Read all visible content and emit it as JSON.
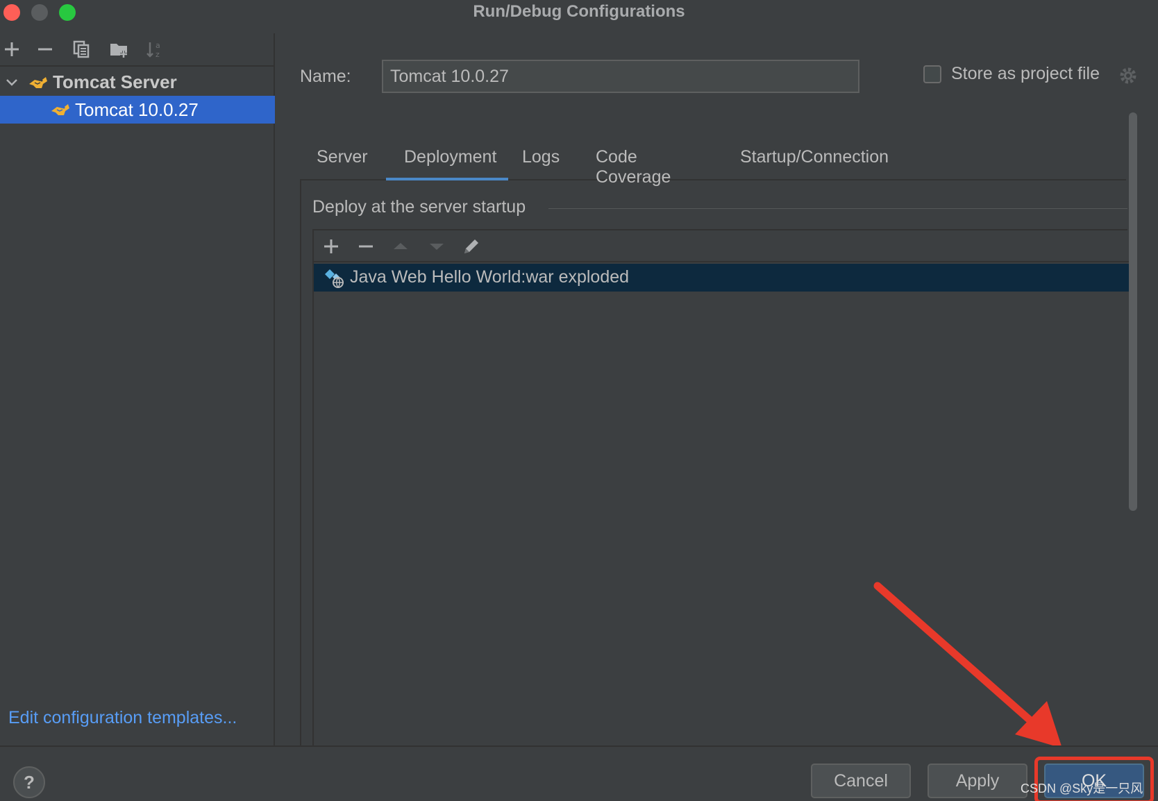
{
  "window": {
    "title": "Run/Debug Configurations"
  },
  "sidebar": {
    "group_label": "Tomcat Server",
    "selected_item_label": "Tomcat 10.0.27",
    "edit_templates_link": "Edit configuration templates..."
  },
  "form": {
    "name_label": "Name:",
    "name_value": "Tomcat 10.0.27",
    "store_label": "Store as project file",
    "store_checked": false
  },
  "tabs": [
    {
      "label": "Server",
      "active": false
    },
    {
      "label": "Deployment",
      "active": true
    },
    {
      "label": "Logs",
      "active": false
    },
    {
      "label": "Code Coverage",
      "active": false
    },
    {
      "label": "Startup/Connection",
      "active": false
    }
  ],
  "deployment": {
    "section_title": "Deploy at the server startup",
    "artifacts": [
      {
        "label": "Java Web Hello World:war exploded"
      }
    ]
  },
  "buttons": {
    "help": "?",
    "cancel": "Cancel",
    "apply": "Apply",
    "ok": "OK"
  },
  "watermark": "CSDN @Sky是一只风",
  "colors": {
    "selection": "#2f65ca",
    "accent": "#4a88c7",
    "link": "#589df6",
    "highlight_red": "#e8392a"
  }
}
